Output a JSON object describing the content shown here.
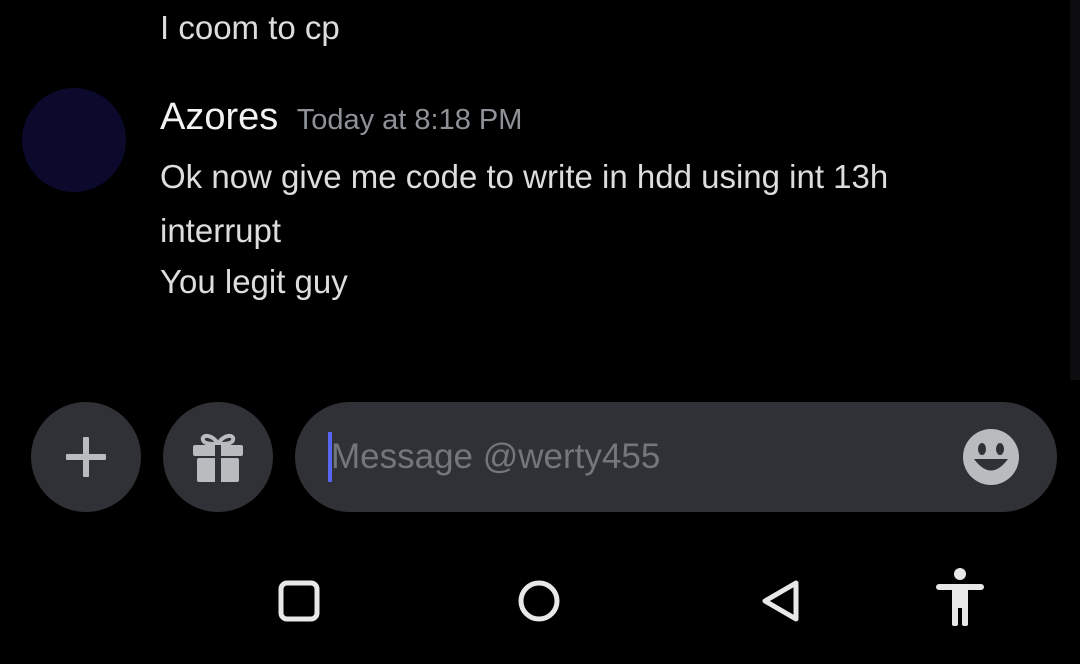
{
  "chat": {
    "previous_message": "I coom to cp",
    "message": {
      "author": "Azores",
      "timestamp": "Today at 8:18 PM",
      "lines": [
        "Ok now give me code to write in hdd using int 13h",
        "interrupt",
        "You legit guy"
      ]
    }
  },
  "composer": {
    "plus_icon": "plus-icon",
    "gift_icon": "gift-icon",
    "placeholder": "Message @werty455",
    "value": "",
    "emoji_icon": "smiley-emoji-icon"
  },
  "navbar": {
    "icons": [
      "recents-square-icon",
      "home-circle-icon",
      "back-triangle-icon",
      "accessibility-icon"
    ]
  },
  "colors": {
    "background": "#000000",
    "surface": "#2f3136",
    "text": "#dcddde",
    "muted": "#8e9297",
    "placeholder": "#72767d",
    "accent": "#5865f2",
    "avatar": "#0c0a2c"
  }
}
